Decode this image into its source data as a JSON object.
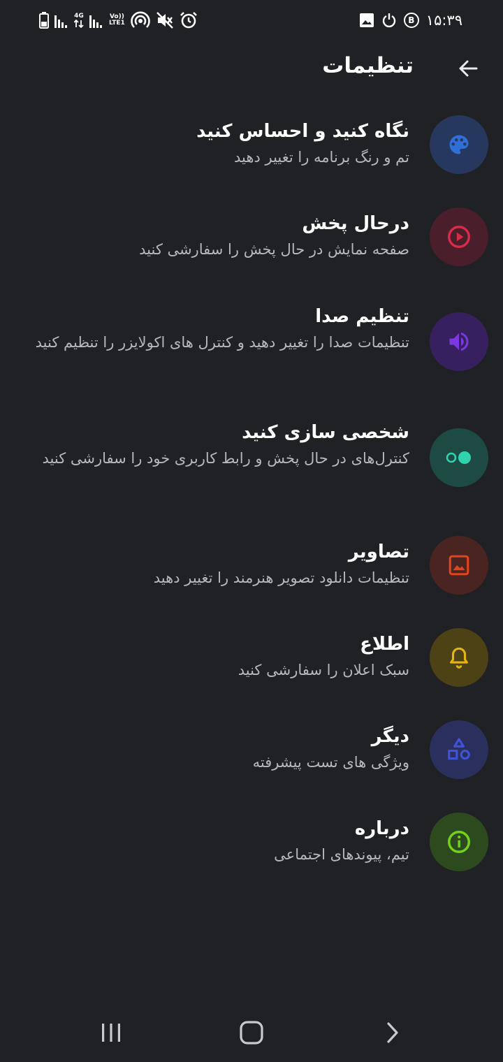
{
  "status_bar": {
    "time": "۱۵:۳۹",
    "network_label_1": "4G",
    "volte_top": "Vo))",
    "volte_bottom": "LTE1",
    "b_badge": "B"
  },
  "header": {
    "title": "تنظیمات"
  },
  "settings": [
    {
      "title": "نگاه کنید و احساس کنید",
      "subtitle": "تم و رنگ برنامه را تغییر دهید",
      "icon": "palette-icon",
      "bg": "#27385f",
      "fg": "#2f6fd6"
    },
    {
      "title": "درحال پخش",
      "subtitle": "صفحه نمایش در حال پخش را سفارشی کنید",
      "icon": "play-circle-icon",
      "bg": "#4a1e2b",
      "fg": "#d62b4a"
    },
    {
      "title": "تنظیم صدا",
      "subtitle": "تنظیمات صدا را تغییر دهید و کنترل های اکولایزر را تنظیم کنید",
      "icon": "volume-icon",
      "bg": "#36215e",
      "fg": "#7a38e0"
    },
    {
      "title": "شخصی سازی کنید",
      "subtitle": "کنترل‌های در حال پخش و رابط کاربری خود را سفارشی کنید",
      "icon": "toggle-dots-icon",
      "bg": "#1d4b43",
      "fg": "#2fd3ad"
    },
    {
      "title": "تصاویر",
      "subtitle": "تنظیمات دانلود تصویر هنرمند را تغییر دهید",
      "icon": "image-icon",
      "bg": "#4a2421",
      "fg": "#e0451d"
    },
    {
      "title": "اطلاع",
      "subtitle": "سبک اعلان را سفارشی کنید",
      "icon": "bell-icon",
      "bg": "#4d4116",
      "fg": "#e6b40f"
    },
    {
      "title": "دیگر",
      "subtitle": "ویژگی های تست پیشرفته",
      "icon": "shapes-icon",
      "bg": "#2a2f5d",
      "fg": "#3f53d6"
    },
    {
      "title": "درباره",
      "subtitle": "تیم، پیوندهای اجتماعی",
      "icon": "info-icon",
      "bg": "#2d4a1f",
      "fg": "#72d11b"
    }
  ],
  "nav_bar": {
    "recents": "recents-icon",
    "home": "home-icon",
    "back": "back-nav-icon"
  }
}
